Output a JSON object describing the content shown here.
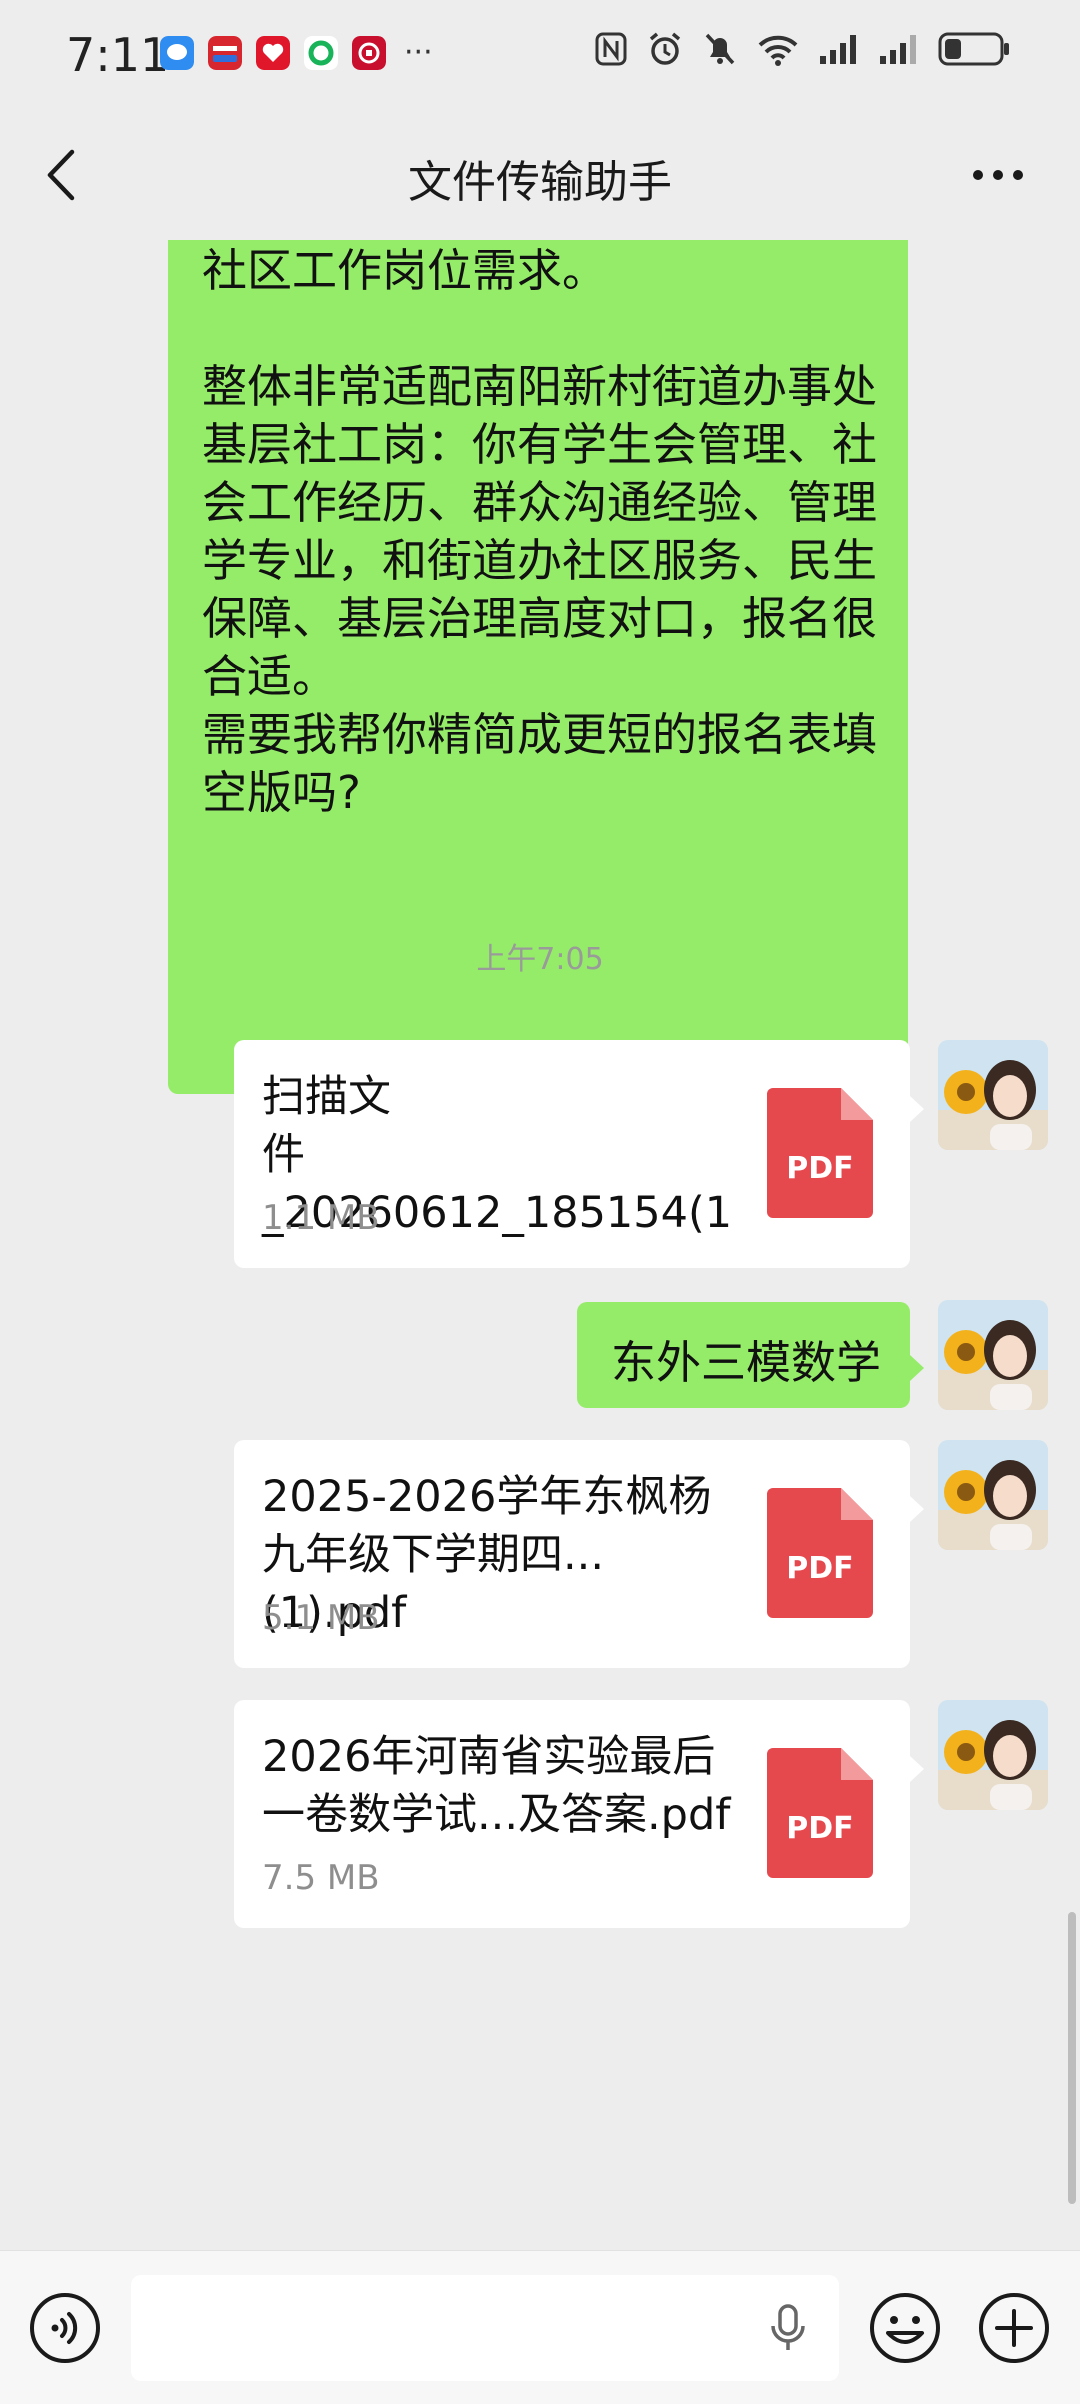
{
  "status_bar": {
    "time": "7:11",
    "app_icons": [
      "chat-app-icon",
      "bank-app-icon",
      "red-app-icon",
      "green-app-icon",
      "bank2-app-icon"
    ],
    "more_dots": "···"
  },
  "nav": {
    "title": "文件传输助手"
  },
  "messages": {
    "long_text": "社区工作岗位需求。\n\n整体非常适配南阳新村街道办事处基层社工岗：你有学生会管理、社会工作经历、群众沟通经验、管理学专业，和街道办社区服务、民生保障、基层治理高度对口，报名很合适。\n需要我帮你精简成更短的报名表填空版吗?",
    "timestamp": "上午7:05",
    "file1": {
      "name": "扫描文\n件_20260612_185154(1",
      "size": "1.1 MB",
      "icon_label": "PDF"
    },
    "text2": "东外三模数学",
    "file2": {
      "name": "2025-2026学年东枫杨\n九年级下学期四...(1).pdf",
      "size": "5.1 MB",
      "icon_label": "PDF"
    },
    "file3": {
      "name": "2026年河南省实验最后\n一卷数学试...及答案.pdf",
      "size": "7.5 MB",
      "icon_label": "PDF"
    }
  },
  "colors": {
    "bubble_green": "#95ec69",
    "pdf_red": "#e5484d",
    "background": "#ededed"
  },
  "input": {
    "placeholder": ""
  }
}
